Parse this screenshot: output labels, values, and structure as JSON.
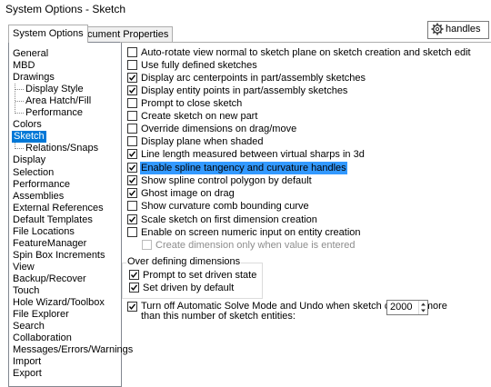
{
  "window": {
    "title": "System Options - Sketch"
  },
  "tabs": [
    {
      "label": "System Options",
      "active": true
    },
    {
      "label": "Document Properties",
      "active": false
    }
  ],
  "search": {
    "value": "handles",
    "icon": "gear-icon"
  },
  "tree": [
    {
      "label": "General",
      "indent": 0
    },
    {
      "label": "MBD",
      "indent": 0
    },
    {
      "label": "Drawings",
      "indent": 0
    },
    {
      "label": "Display Style",
      "indent": 1
    },
    {
      "label": "Area Hatch/Fill",
      "indent": 1
    },
    {
      "label": "Performance",
      "indent": 1
    },
    {
      "label": "Colors",
      "indent": 0
    },
    {
      "label": "Sketch",
      "indent": 0,
      "selected": true
    },
    {
      "label": "Relations/Snaps",
      "indent": 1
    },
    {
      "label": "Display",
      "indent": 0
    },
    {
      "label": "Selection",
      "indent": 0
    },
    {
      "label": "Performance",
      "indent": 0
    },
    {
      "label": "Assemblies",
      "indent": 0
    },
    {
      "label": "External References",
      "indent": 0
    },
    {
      "label": "Default Templates",
      "indent": 0
    },
    {
      "label": "File Locations",
      "indent": 0
    },
    {
      "label": "FeatureManager",
      "indent": 0
    },
    {
      "label": "Spin Box Increments",
      "indent": 0
    },
    {
      "label": "View",
      "indent": 0
    },
    {
      "label": "Backup/Recover",
      "indent": 0
    },
    {
      "label": "Touch",
      "indent": 0
    },
    {
      "label": "Hole Wizard/Toolbox",
      "indent": 0
    },
    {
      "label": "File Explorer",
      "indent": 0
    },
    {
      "label": "Search",
      "indent": 0
    },
    {
      "label": "Collaboration",
      "indent": 0
    },
    {
      "label": "Messages/Errors/Warnings",
      "indent": 0
    },
    {
      "label": "Import",
      "indent": 0
    },
    {
      "label": "Export",
      "indent": 0
    }
  ],
  "options": [
    {
      "label": "Auto-rotate view normal to sketch plane on sketch creation and sketch edit",
      "checked": false
    },
    {
      "label": "Use fully defined sketches",
      "checked": false
    },
    {
      "label": "Display arc centerpoints in part/assembly sketches",
      "checked": true
    },
    {
      "label": "Display entity points in part/assembly sketches",
      "checked": true
    },
    {
      "label": "Prompt to close sketch",
      "checked": false
    },
    {
      "label": "Create sketch on new part",
      "checked": false
    },
    {
      "label": "Override dimensions on drag/move",
      "checked": false
    },
    {
      "label": "Display plane when shaded",
      "checked": false
    },
    {
      "label": "Line length measured between virtual sharps in 3d",
      "checked": true
    },
    {
      "label": "Enable spline tangency and curvature handles",
      "checked": true,
      "highlighted": true
    },
    {
      "label": "Show spline control polygon by default",
      "checked": true
    },
    {
      "label": "Ghost image on drag",
      "checked": true
    },
    {
      "label": "Show curvature comb bounding curve",
      "checked": false
    },
    {
      "label": "Scale sketch on first dimension creation",
      "checked": true
    },
    {
      "label": "Enable on screen numeric input on entity creation",
      "checked": false
    },
    {
      "label": "Create dimension only when value is entered",
      "checked": false,
      "disabled": true
    }
  ],
  "overdefining": {
    "title": "Over defining dimensions",
    "options": [
      {
        "label": "Prompt to set driven state",
        "checked": true
      },
      {
        "label": "Set driven by default",
        "checked": true
      }
    ]
  },
  "solve_mode": {
    "label_line1": "Turn off Automatic Solve Mode and Undo when sketch contains more",
    "label_line2": "than this number of sketch entities:",
    "checked": true,
    "value": "2000"
  },
  "colors": {
    "selection": "#0078d7",
    "highlight": "#3399ff"
  }
}
